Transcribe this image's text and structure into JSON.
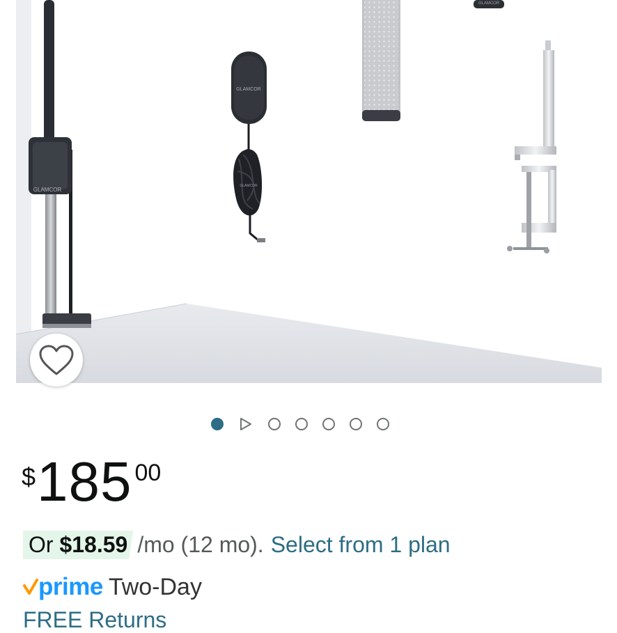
{
  "product_image": {
    "brand_on_clamp": "GLAMCOR",
    "brand_on_adapter": "GLAMCOR",
    "brand_on_cable": "GLAMCOR",
    "brand_on_remote": "GLAMCOR"
  },
  "carousel": {
    "total_dots": 7,
    "active_index": 0,
    "video_index": 1
  },
  "price": {
    "symbol": "$",
    "whole": "185",
    "fraction": "00"
  },
  "installment": {
    "prefix": "Or ",
    "amount": "$18.59",
    "terms": "/mo (12 mo).",
    "link": "Select from 1 plan"
  },
  "delivery": {
    "prime_word": "prime",
    "prime_text": "Two-Day",
    "free_returns": "FREE Returns"
  },
  "colors": {
    "link": "#2d6d85",
    "prime_blue": "#1a98ff",
    "prime_check": "#ff9900",
    "installment_badge": "#e4f5e9"
  }
}
